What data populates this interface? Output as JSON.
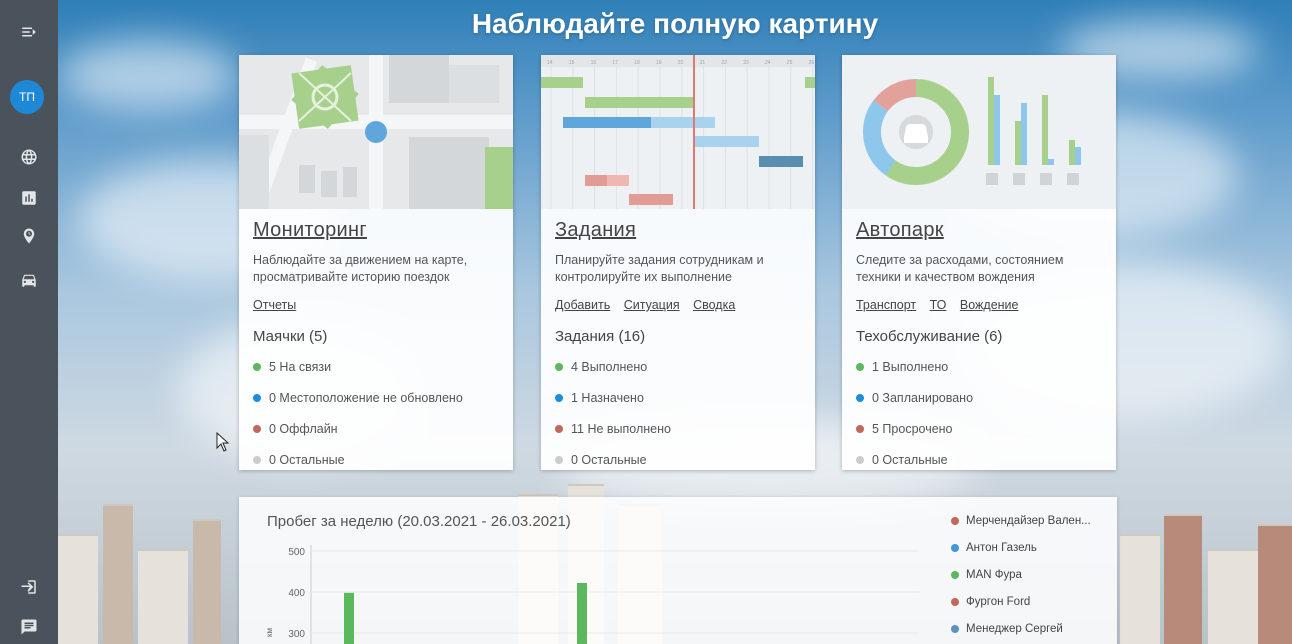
{
  "sidebar": {
    "avatar_initials": "ТП",
    "items": [
      {
        "icon": "menu-expand-icon"
      },
      {
        "icon": "globe-icon"
      },
      {
        "icon": "bar-chart-icon"
      },
      {
        "icon": "clock-icon"
      },
      {
        "icon": "car-icon"
      },
      {
        "icon": "logout-icon"
      },
      {
        "icon": "chat-icon"
      }
    ]
  },
  "hero": {
    "title": "Наблюдайте полную картину"
  },
  "cards": {
    "monitoring": {
      "title": "Мониторинг",
      "desc": "Наблюдайте за движением на карте, просматривайте историю поездок",
      "links": [
        "Отчеты"
      ],
      "section": "Маячки (5)",
      "stats": [
        {
          "text": "5 На связи",
          "color": "#5cb85c"
        },
        {
          "text": "0 Местоположение не обновлено",
          "color": "#1f8dd6"
        },
        {
          "text": "0 Оффлайн",
          "color": "#c0685a"
        },
        {
          "text": "0 Остальные",
          "color": "#cccccc"
        }
      ]
    },
    "tasks": {
      "title": "Задания",
      "desc": "Планируйте задания сотрудникам и контролируйте их выполнение",
      "links": [
        "Добавить",
        "Ситуация",
        "Сводка"
      ],
      "section": "Задания (16)",
      "stats": [
        {
          "text": "4 Выполнено",
          "color": "#5cb85c"
        },
        {
          "text": "1 Назначено",
          "color": "#1f8dd6"
        },
        {
          "text": "11 Не выполнено",
          "color": "#c0685a"
        },
        {
          "text": "0 Остальные",
          "color": "#cccccc"
        }
      ],
      "gantt_ticks": [
        "14",
        "15",
        "16",
        "17",
        "18",
        "19",
        "20",
        "21",
        "22",
        "23",
        "24",
        "25",
        "26"
      ]
    },
    "fleet": {
      "title": "Автопарк",
      "desc": "Следите за расходами, состоянием техники и качеством вождения",
      "links": [
        "Транспорт",
        "ТО",
        "Вождение"
      ],
      "section": "Техобслуживание (6)",
      "stats": [
        {
          "text": "1 Выполнено",
          "color": "#5cb85c"
        },
        {
          "text": "0 Запланировано",
          "color": "#1f8dd6"
        },
        {
          "text": "5 Просрочено",
          "color": "#c0685a"
        },
        {
          "text": "0 Остальные",
          "color": "#cccccc"
        }
      ]
    }
  },
  "mileage": {
    "title": "Пробег за неделю (20.03.2021 - 26.03.2021)",
    "legend": [
      {
        "name": "Мерчендайзер Вален...",
        "color": "#c0685a"
      },
      {
        "name": "Антон Газель",
        "color": "#3f97d6"
      },
      {
        "name": "MAN Фура",
        "color": "#5cb85c"
      },
      {
        "name": "Фургон Ford",
        "color": "#c0685a"
      },
      {
        "name": "Менеджер Сергей",
        "color": "#5a93c2"
      }
    ]
  },
  "chart_data": {
    "type": "bar",
    "title": "Пробег за неделю (20.03.2021 - 26.03.2021)",
    "ylabel": "км",
    "yticks": [
      300,
      400,
      500
    ],
    "ylim": [
      200,
      500
    ],
    "series": [
      {
        "name": "MAN Фура",
        "color": "#5cb85c",
        "bars": [
          {
            "slot": 0,
            "value": 398
          },
          {
            "slot": 1,
            "value": 422
          }
        ]
      }
    ]
  }
}
